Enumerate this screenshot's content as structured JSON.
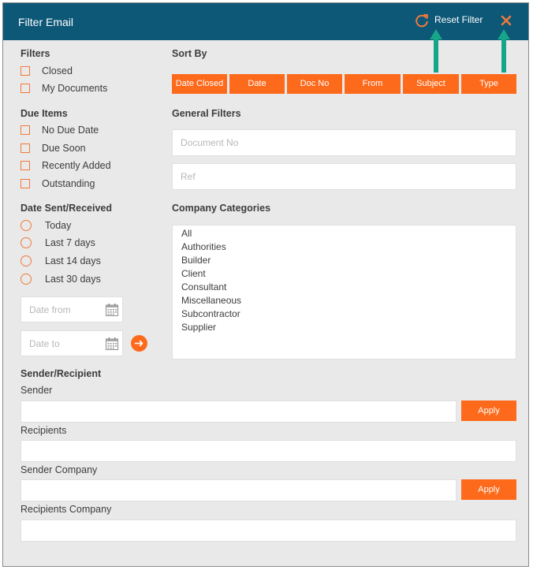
{
  "header": {
    "title": "Filter Email",
    "reset_label": "Reset Filter"
  },
  "filters": {
    "heading": "Filters",
    "items": [
      "Closed",
      "My Documents"
    ]
  },
  "due_items": {
    "heading": "Due Items",
    "items": [
      "No Due Date",
      "Due Soon",
      "Recently Added",
      "Outstanding"
    ]
  },
  "date_sent": {
    "heading": "Date Sent/Received",
    "items": [
      "Today",
      "Last 7 days",
      "Last 14 days",
      "Last 30 days"
    ],
    "from_placeholder": "Date from",
    "to_placeholder": "Date to"
  },
  "sort_by": {
    "heading": "Sort By",
    "buttons": [
      "Date Closed",
      "Date",
      "Doc No",
      "From",
      "Subject",
      "Type"
    ]
  },
  "general_filters": {
    "heading": "General Filters",
    "doc_no_placeholder": "Document No",
    "ref_placeholder": "Ref"
  },
  "company_categories": {
    "heading": "Company Categories",
    "items": [
      "All",
      "Authorities",
      "Builder",
      "Client",
      "Consultant",
      "Miscellaneous",
      "Subcontractor",
      "Supplier"
    ]
  },
  "sender_recipient": {
    "heading": "Sender/Recipient",
    "sender_label": "Sender",
    "recipients_label": "Recipients",
    "sender_company_label": "Sender Company",
    "recipients_company_label": "Recipients Company",
    "apply_label": "Apply"
  },
  "colors": {
    "header": "#0d5777",
    "accent": "#fe6a1c",
    "arrow": "#17a589",
    "panel": "#e9e9e9"
  },
  "icons": [
    "refresh-icon",
    "close-icon",
    "calendar-icon",
    "arrow-right-icon",
    "arrow-up-icon"
  ]
}
